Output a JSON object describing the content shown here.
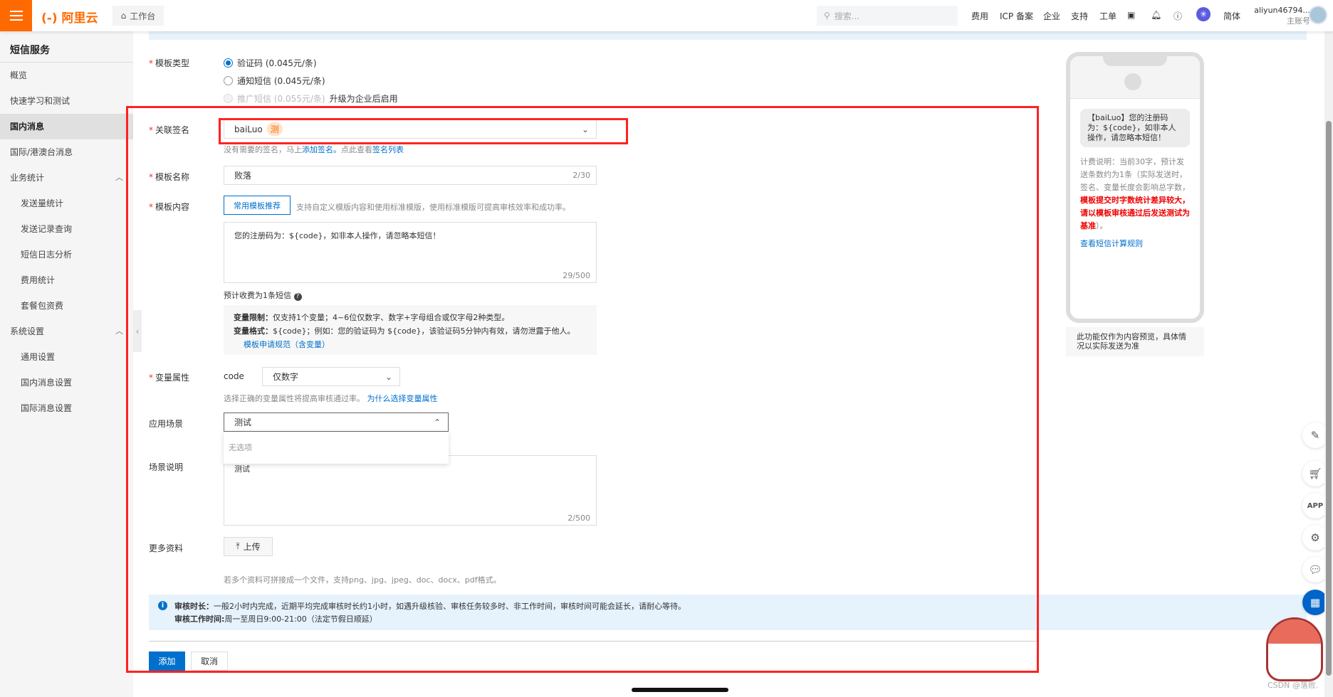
{
  "header": {
    "logo": "阿里云",
    "workbench": "工作台",
    "search_placeholder": "搜索...",
    "nav": [
      "费用",
      "ICP 备案",
      "企业",
      "支持",
      "工单"
    ],
    "lang": "简体",
    "user": "aliyun46794...",
    "account_type": "主账号",
    "accent": "#ff6a00"
  },
  "sidebar": {
    "title": "短信服务",
    "items": [
      {
        "label": "概览"
      },
      {
        "label": "快速学习和测试"
      },
      {
        "label": "国内消息",
        "active": true
      },
      {
        "label": "国际/港澳台消息"
      },
      {
        "label": "业务统计",
        "group": true
      },
      {
        "label": "发送量统计"
      },
      {
        "label": "发送记录查询"
      },
      {
        "label": "短信日志分析"
      },
      {
        "label": "费用统计"
      },
      {
        "label": "套餐包资费"
      },
      {
        "label": "系统设置",
        "group": true
      },
      {
        "label": "通用设置"
      },
      {
        "label": "国内消息设置"
      },
      {
        "label": "国际消息设置"
      }
    ]
  },
  "form": {
    "type_label": "模板类型",
    "types": [
      {
        "label": "验证码 (0.045元/条)",
        "checked": true
      },
      {
        "label": "通知短信 (0.045元/条)"
      },
      {
        "label": "推广短信 (0.055元/条)",
        "disabled": true
      }
    ],
    "upgrade_note": "升级为企业后启用",
    "sig_label": "关联签名",
    "sig_value": "baiLuo",
    "sig_tag": "测",
    "sig_help_1": "没有需要的签名，马上",
    "sig_help_link1": "添加签名。",
    "sig_help_2": "点此查看",
    "sig_help_link2": "签名列表",
    "name_label": "模板名称",
    "name_value": "败落",
    "name_count": "2/30",
    "content_label": "模板内容",
    "tpl_btn": "常用模板推荐",
    "content_help": "支持自定义模版内容和使用标准模版，使用标准模版可提高审核效率和成功率。",
    "content_value": "您的注册码为：${code}，如非本人操作，请忽略本短信！",
    "content_count": "29/500",
    "estimate": "预计收费为1条短信",
    "var_limit_label": "变量限制：",
    "var_limit": "仅支持1个变量；4~6位仅数字、数字+字母组合或仅字母2种类型。",
    "var_format_label": "变量格式：",
    "var_format": "${code}；例如：您的验证码为 ${code}，该验证码5分钟内有效，请勿泄露于他人。",
    "var_link": "模板申请规范（含变量）",
    "var_attr_label": "变量属性",
    "var_name": "code",
    "var_type": "仅数字",
    "var_help": "选择正确的变量属性将提高审核通过率。",
    "var_help_link": "为什么选择变量属性",
    "scene_label": "应用场景",
    "scene_value": "测试",
    "scene_empty": "无选项",
    "desc_label": "场景说明",
    "desc_value": "测试",
    "desc_count": "2/500",
    "more_label": "更多资料",
    "upload": "上传",
    "upload_help": "若多个资料可拼接成一个文件，支持png、jpg、jpeg、doc、docx、pdf格式。",
    "review_label": "审核时长：",
    "review_text": "一般2小时内完成，近期平均完成审核时长约1小时，如遇升级核验、审核任务较多时、非工作时间，审核时间可能会延长，请耐心等待。",
    "hours_label": "审核工作时间:",
    "hours_text": "周一至周日9:00-21:00（法定节假日顺延）",
    "add": "添加",
    "cancel": "取消"
  },
  "preview": {
    "bubble": "【baiLuo】您的注册码为：${code}，如非本人操作，请忽略本短信！",
    "billing_1": "计费说明：当前30字，预计发送条数约为1条（实际发送时，签名、变量长度会影响总字数，",
    "billing_red": "模板提交时字数统计差异较大，请以模板审核通过后发送测试为基准",
    "billing_2": "）。",
    "calc_link": "查看短信计算规则",
    "caption": "此功能仅作为内容预览，具体情况以实际发送为准"
  },
  "watermark": "CSDN @落败."
}
